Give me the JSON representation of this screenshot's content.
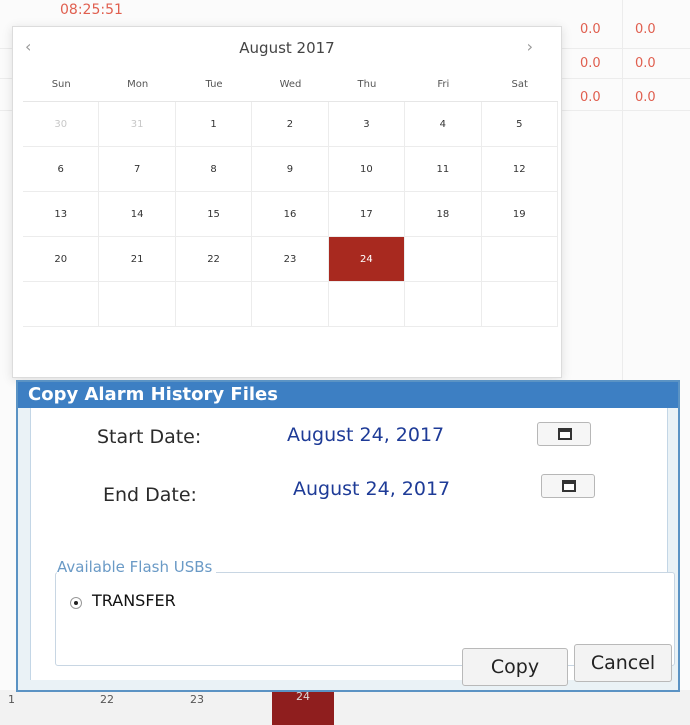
{
  "background": {
    "time": "08:25:51",
    "values": [
      [
        "0.0",
        "0.0"
      ],
      [
        "0.0",
        "0.0"
      ],
      [
        "0.0",
        "0.0"
      ]
    ],
    "bottom_row": [
      "1",
      "22",
      "23",
      "24"
    ]
  },
  "calendar": {
    "month_title": "August 2017",
    "prev_icon": "chevron-left-icon",
    "next_icon": "chevron-right-icon",
    "weekdays": [
      "Sun",
      "Mon",
      "Tue",
      "Wed",
      "Thu",
      "Fri",
      "Sat"
    ],
    "days": [
      {
        "label": "30",
        "muted": true
      },
      {
        "label": "31",
        "muted": true
      },
      {
        "label": "1"
      },
      {
        "label": "2"
      },
      {
        "label": "3"
      },
      {
        "label": "4"
      },
      {
        "label": "5"
      },
      {
        "label": "6"
      },
      {
        "label": "7"
      },
      {
        "label": "8"
      },
      {
        "label": "9"
      },
      {
        "label": "10"
      },
      {
        "label": "11"
      },
      {
        "label": "12"
      },
      {
        "label": "13"
      },
      {
        "label": "14"
      },
      {
        "label": "15"
      },
      {
        "label": "16"
      },
      {
        "label": "17"
      },
      {
        "label": "18"
      },
      {
        "label": "19"
      },
      {
        "label": "20"
      },
      {
        "label": "21"
      },
      {
        "label": "22"
      },
      {
        "label": "23"
      },
      {
        "label": "24",
        "selected": true
      },
      {
        "label": ""
      },
      {
        "label": ""
      },
      {
        "label": ""
      },
      {
        "label": ""
      },
      {
        "label": ""
      },
      {
        "label": ""
      },
      {
        "label": ""
      },
      {
        "label": ""
      },
      {
        "label": ""
      }
    ],
    "selected_color": "#a8291f"
  },
  "dialog": {
    "title": "Copy Alarm History Files",
    "start_label": "Start Date:",
    "start_value": "August 24, 2017",
    "end_label": "End Date:",
    "end_value": "August 24, 2017",
    "calendar_button_icon": "calendar-icon",
    "usb_legend": "Available Flash USBs",
    "usb_options": [
      {
        "label": "TRANSFER",
        "selected": true
      }
    ],
    "copy_label": "Copy",
    "cancel_label": "Cancel",
    "title_color": "#3d7fc3",
    "date_color": "#1e3b97"
  }
}
